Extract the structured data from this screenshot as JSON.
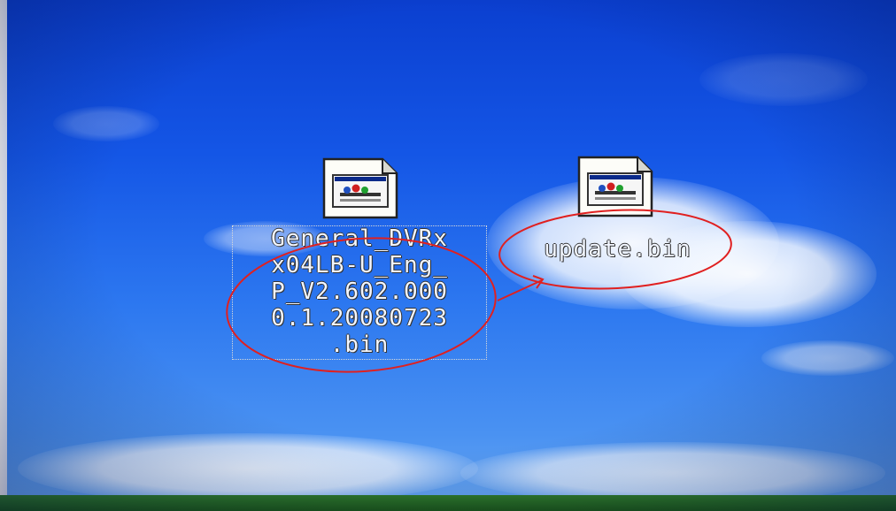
{
  "desktop": {
    "icons": [
      {
        "label_lines": [
          "General_DVRx",
          "x04LB-U_Eng_",
          "P_V2.602.000",
          "0.1.20080723",
          ".bin"
        ],
        "icon": "bin-file-icon"
      },
      {
        "label_lines": [
          "update.bin"
        ],
        "icon": "bin-file-icon"
      }
    ]
  },
  "colors": {
    "sky_top": "#0b3fd0",
    "sky_bottom": "#6aa8f2",
    "annotation": "#e02020"
  }
}
